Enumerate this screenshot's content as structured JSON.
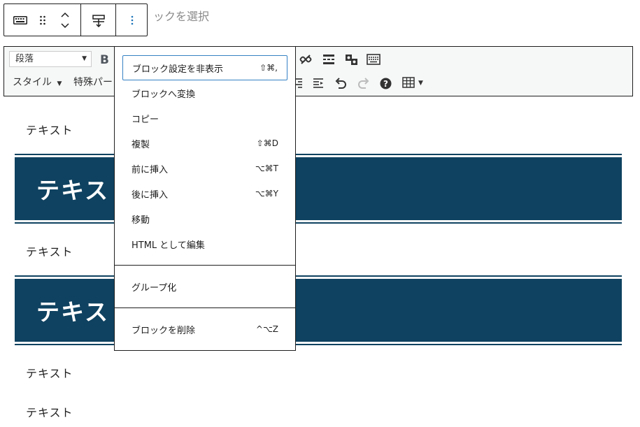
{
  "block_toolbar": {
    "icons": [
      "keyboard-icon",
      "drag-handle-icon",
      "chevron-up-icon",
      "chevron-down-icon",
      "align-icon",
      "more-options-icon"
    ]
  },
  "select_parent": {
    "label": "ックを選択"
  },
  "classic_toolbar": {
    "format_select": "段落",
    "bold": "B",
    "style_menu": "スタイル",
    "special_menu": "特殊パー"
  },
  "content": {
    "paragraphs": [
      "テキスト",
      "テキスト",
      "テキスト",
      "テキスト"
    ],
    "headings": [
      "テキスト",
      "テキスト"
    ],
    "heading_color": "#0f4260"
  },
  "menu": {
    "items": [
      {
        "label": "ブロック設定を非表示",
        "shortcut": "⇧⌘,"
      },
      {
        "label": "ブロックへ変換",
        "shortcut": ""
      },
      {
        "label": "コピー",
        "shortcut": ""
      },
      {
        "label": "複製",
        "shortcut": "⇧⌘D"
      },
      {
        "label": "前に挿入",
        "shortcut": "⌥⌘T"
      },
      {
        "label": "後に挿入",
        "shortcut": "⌥⌘Y"
      },
      {
        "label": "移動",
        "shortcut": ""
      },
      {
        "label": "HTML として編集",
        "shortcut": ""
      }
    ],
    "group": {
      "label": "グループ化"
    },
    "delete": {
      "label": "ブロックを削除",
      "shortcut": "^⌥Z"
    }
  }
}
